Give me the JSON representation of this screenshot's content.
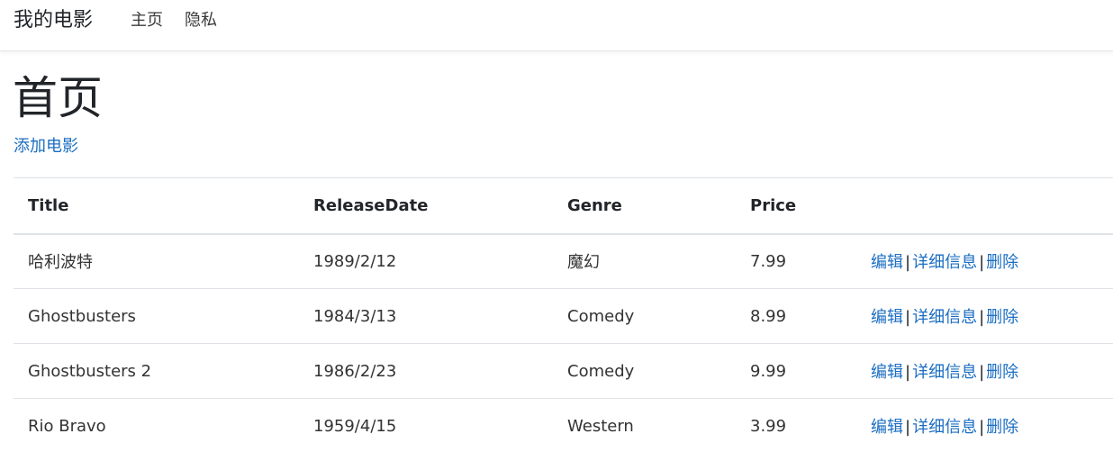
{
  "navbar": {
    "brand": "我的电影",
    "links": [
      {
        "label": "主页"
      },
      {
        "label": "隐私"
      }
    ]
  },
  "main": {
    "title": "首页",
    "add_link": "添加电影"
  },
  "table": {
    "headers": [
      "Title",
      "ReleaseDate",
      "Genre",
      "Price",
      ""
    ],
    "rows": [
      {
        "title": "哈利波特",
        "release_date": "1989/2/12",
        "genre": "魔幻",
        "price": "7.99"
      },
      {
        "title": "Ghostbusters",
        "release_date": "1984/3/13",
        "genre": "Comedy",
        "price": "8.99"
      },
      {
        "title": "Ghostbusters 2",
        "release_date": "1986/2/23",
        "genre": "Comedy",
        "price": "9.99"
      },
      {
        "title": "Rio Bravo",
        "release_date": "1959/4/15",
        "genre": "Western",
        "price": "3.99"
      }
    ],
    "actions": {
      "edit": "编辑",
      "details": "详细信息",
      "delete": "删除",
      "separator": "|"
    }
  },
  "colors": {
    "link": "#1b6ec2",
    "text": "#212529",
    "border": "#dee2e6"
  }
}
